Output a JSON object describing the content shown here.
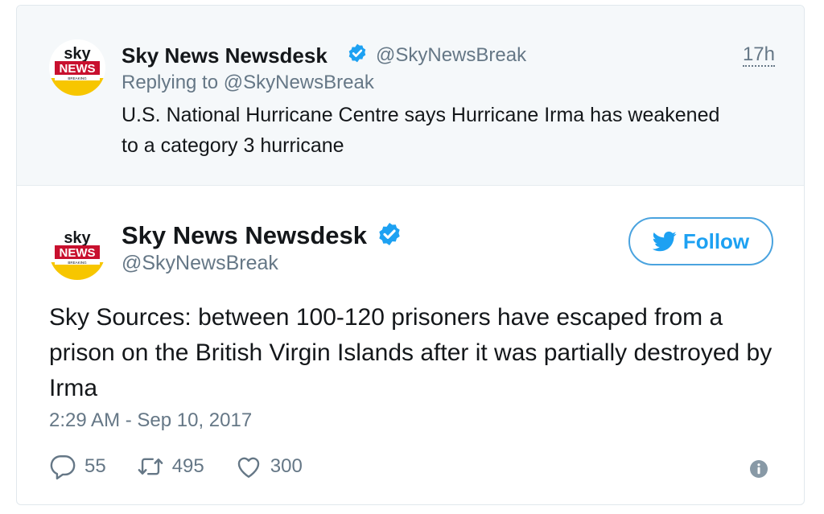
{
  "parent_tweet": {
    "display_name": "Sky News Newsdesk",
    "handle": "@SkyNewsBreak",
    "time": "17h",
    "replying_prefix": "Replying to",
    "replying_to": "@SkyNewsBreak",
    "text": "U.S. National Hurricane Centre says Hurricane Irma has weakened to a category 3 hurricane"
  },
  "main_tweet": {
    "display_name": "Sky News Newsdesk",
    "handle": "@SkyNewsBreak",
    "follow_label": "Follow",
    "text": "Sky Sources: between 100-120 prisoners have escaped from a prison on the British Virgin Islands after it was partially destroyed by Irma",
    "timestamp": "2:29 AM - Sep 10, 2017",
    "reply_count": "55",
    "retweet_count": "495",
    "like_count": "300"
  },
  "avatar_logo": {
    "top": "sky",
    "middle": "NEWS",
    "bottom": "BREAKING"
  },
  "colors": {
    "accent": "#1da1f2",
    "muted": "#657786",
    "text": "#14171a",
    "parent_bg": "#f5f8fa",
    "verified": "#1da1f2",
    "news_red": "#c8102e",
    "breaking_yellow": "#f7c600"
  },
  "icons": {
    "verified": "verified-badge-icon",
    "follow": "twitter-bird-icon",
    "reply": "reply-icon",
    "retweet": "retweet-icon",
    "like": "heart-icon",
    "info": "info-icon"
  }
}
